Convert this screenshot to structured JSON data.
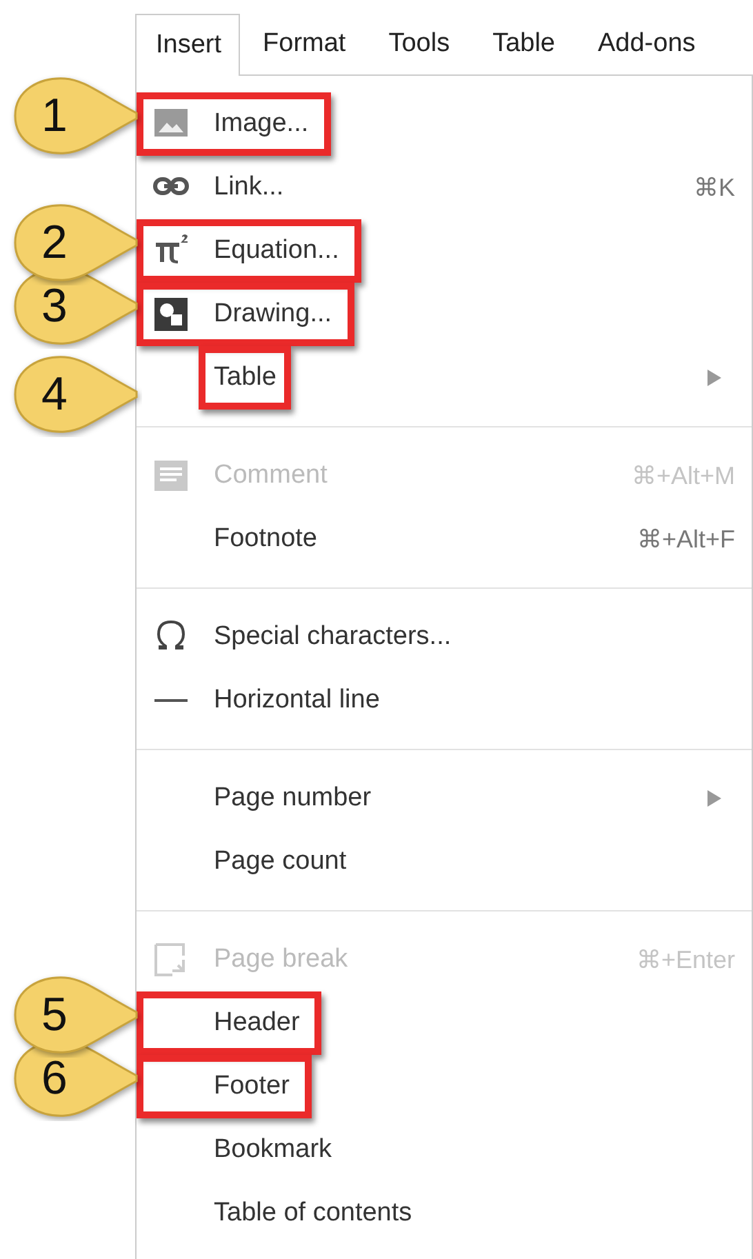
{
  "menubar": {
    "tabs": [
      {
        "label": "Insert",
        "selected": true
      },
      {
        "label": "Format",
        "selected": false
      },
      {
        "label": "Tools",
        "selected": false
      },
      {
        "label": "Table",
        "selected": false
      },
      {
        "label": "Add-ons",
        "selected": false
      }
    ]
  },
  "menu": {
    "groups": [
      {
        "items": [
          {
            "label": "Image...",
            "kind": "image",
            "disabled": false,
            "submenu": false,
            "highlighted": true,
            "callout": "1"
          },
          {
            "label": "Link...",
            "kind": "link",
            "shortcut": "⌘K",
            "disabled": false,
            "submenu": false,
            "highlighted": false
          },
          {
            "label": "Equation...",
            "kind": "equation",
            "disabled": false,
            "submenu": false,
            "highlighted": true,
            "callout": "2"
          },
          {
            "label": "Drawing...",
            "kind": "drawing",
            "disabled": false,
            "submenu": false,
            "highlighted": true,
            "callout": "3"
          },
          {
            "label": "Table",
            "kind": "submenu",
            "disabled": false,
            "submenu": true,
            "highlighted": true,
            "callout": "4"
          }
        ]
      },
      {
        "items": [
          {
            "label": "Comment",
            "kind": "comment",
            "shortcut": "⌘+Alt+M",
            "disabled": true,
            "submenu": false,
            "highlighted": false
          },
          {
            "label": "Footnote",
            "kind": "plain",
            "shortcut": "⌘+Alt+F",
            "disabled": false,
            "submenu": false,
            "highlighted": false
          }
        ]
      },
      {
        "items": [
          {
            "label": "Special characters...",
            "kind": "omega",
            "disabled": false,
            "submenu": false,
            "highlighted": false
          },
          {
            "label": "Horizontal line",
            "kind": "hline",
            "disabled": false,
            "submenu": false,
            "highlighted": false
          }
        ]
      },
      {
        "items": [
          {
            "label": "Page number",
            "kind": "submenu",
            "disabled": false,
            "submenu": true,
            "highlighted": false
          },
          {
            "label": "Page count",
            "kind": "plain",
            "disabled": false,
            "submenu": false,
            "highlighted": false
          }
        ]
      },
      {
        "items": [
          {
            "label": "Page break",
            "kind": "pagebreak",
            "shortcut": "⌘+Enter",
            "disabled": true,
            "submenu": false,
            "highlighted": false
          },
          {
            "label": "Header",
            "kind": "plain",
            "disabled": false,
            "submenu": false,
            "highlighted": true,
            "callout": "5"
          },
          {
            "label": "Footer",
            "kind": "plain",
            "disabled": false,
            "submenu": false,
            "highlighted": true,
            "callout": "6"
          },
          {
            "label": "Bookmark",
            "kind": "plain",
            "disabled": false,
            "submenu": false,
            "highlighted": false
          },
          {
            "label": "Table of contents",
            "kind": "plain",
            "disabled": false,
            "submenu": false,
            "highlighted": false
          }
        ]
      }
    ]
  }
}
